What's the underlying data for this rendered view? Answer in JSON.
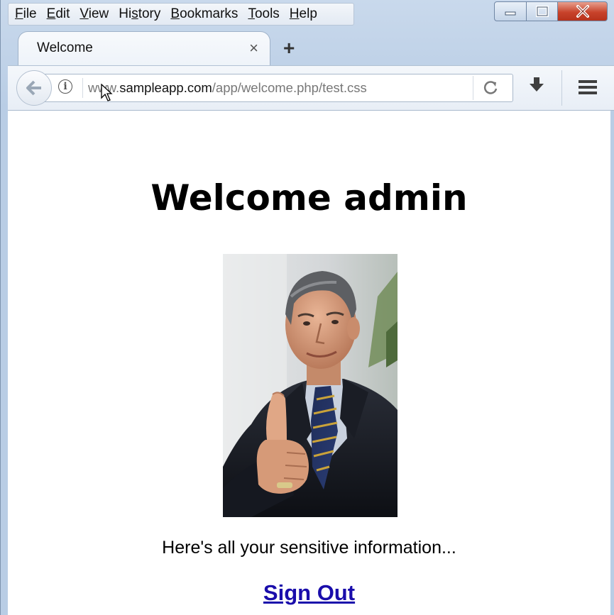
{
  "menubar": {
    "items": [
      {
        "accel": "F",
        "rest": "ile"
      },
      {
        "accel": "E",
        "rest": "dit"
      },
      {
        "accel": "V",
        "rest": "iew"
      },
      {
        "pre": "Hi",
        "accel": "s",
        "rest": "tory"
      },
      {
        "accel": "B",
        "rest": "ookmarks"
      },
      {
        "accel": "T",
        "rest": "ools"
      },
      {
        "accel": "H",
        "rest": "elp"
      }
    ]
  },
  "tab": {
    "title": "Welcome",
    "close": "×"
  },
  "newtab": "+",
  "url": {
    "prefix": "www.",
    "domain": "sampleapp.com",
    "path": "/app/welcome.php/test.css"
  },
  "page": {
    "heading": "Welcome admin",
    "info_text": "Here's all your sensitive information...",
    "signout_label": "Sign Out"
  },
  "colors": {
    "link": "#1a0dab",
    "close_button": "#c8432b",
    "chrome": "#b9cde5"
  },
  "icons": [
    "back-arrow-icon",
    "info-icon",
    "reload-icon",
    "download-icon",
    "hamburger-menu-icon",
    "minimize-icon",
    "maximize-icon",
    "close-icon"
  ]
}
